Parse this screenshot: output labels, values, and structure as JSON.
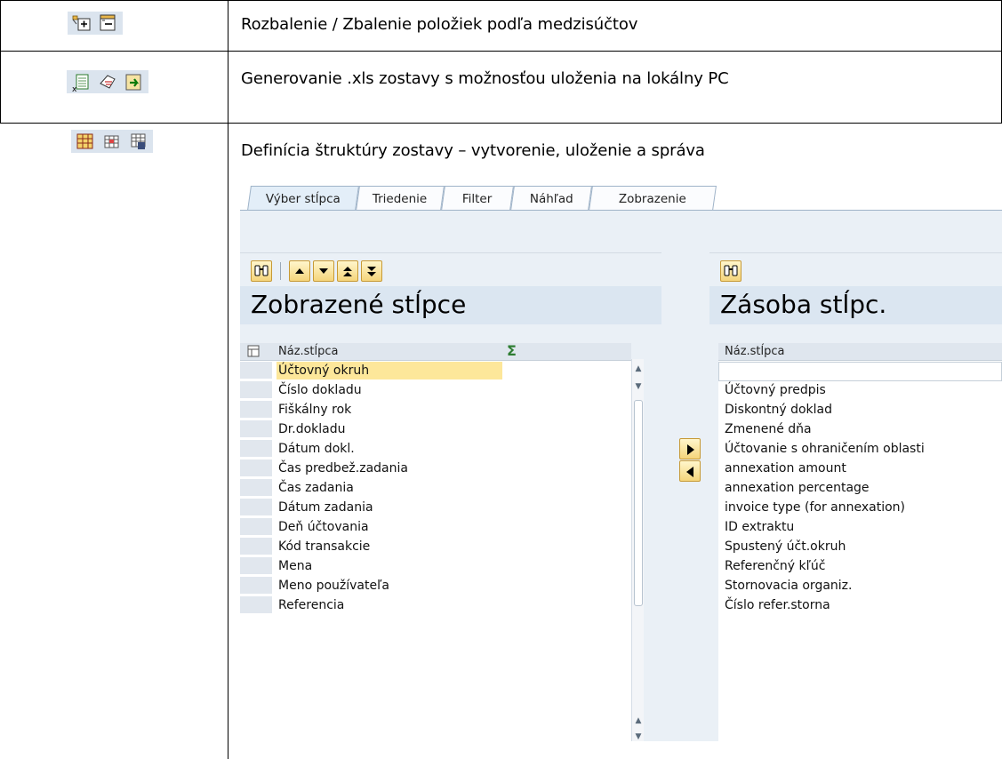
{
  "rows": [
    {
      "text": "Rozbalenie / Zbalenie položiek podľa medzisúčtov",
      "icons": [
        "expand-subtotals-icon",
        "collapse-subtotals-icon"
      ]
    },
    {
      "text": "Generovanie .xls zostavy s možnosťou uloženia na lokálny PC",
      "icons": [
        "export-spreadsheet-icon",
        "local-file-icon",
        "send-export-icon"
      ]
    },
    {
      "text": "Definícia štruktúry zostavy – vytvorenie, uloženie a správa",
      "icons": [
        "change-layout-icon",
        "select-layout-icon",
        "save-layout-icon"
      ]
    }
  ],
  "dialog": {
    "tabs": [
      "Výber stĺpca",
      "Triedenie",
      "Filter",
      "Náhľad",
      "Zobrazenie"
    ],
    "active_tab": "Výber stĺpca",
    "left": {
      "title": "Zobrazené stĺpce",
      "col_header": "Náz.stĺpca",
      "sum_symbol": "Σ",
      "items": [
        "Účtovný okruh",
        "Číslo dokladu",
        "Fiškálny rok",
        "Dr.dokladu",
        "Dátum dokl.",
        "Čas predbež.zadania",
        "Čas zadania",
        "Dátum zadania",
        "Deň účtovania",
        "Kód transakcie",
        "Mena",
        "Meno používateľa",
        "Referencia"
      ],
      "selected_item": "Účtovný okruh"
    },
    "right": {
      "title": "Zásoba stĺpc.",
      "col_header": "Náz.stĺpca",
      "items": [
        "",
        "Účtovný predpis",
        "Diskontný doklad",
        "Zmenené dňa",
        "Účtovanie s ohraničením oblasti",
        "annexation amount",
        "annexation percentage",
        "invoice type (for annexation)",
        "ID extraktu",
        "Spustený účt.okruh",
        "Referenčný kľúč",
        "Stornovacia organiz.",
        "Číslo refer.storna"
      ]
    },
    "colors": {
      "highlight": "#fde79a",
      "panel_bg": "#eaf0f6",
      "title_bg": "#dbe6f1",
      "button_border": "#c79a36"
    }
  }
}
